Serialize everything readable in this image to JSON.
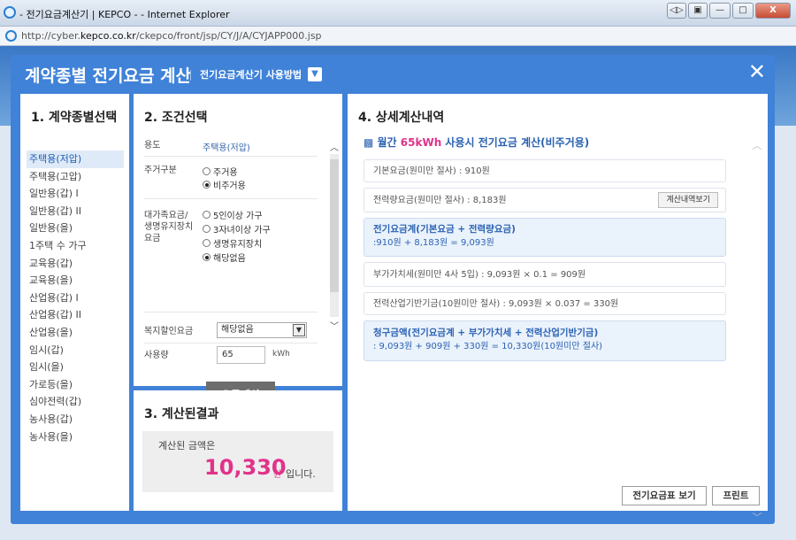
{
  "browser": {
    "title": "- 전기요금계산기 | KEPCO - - Internet Explorer",
    "url_prefix": "http://cyber.",
    "url_domain": "kepco.co.kr",
    "url_path": "/ckepco/front/jsp/CY/J/A/CYJAPP000.jsp",
    "buttons": [
      "◁▷",
      "▣",
      "—",
      "□",
      "X"
    ]
  },
  "modal": {
    "title": "계약종별 전기요금 계산",
    "help_link": "전기요금계산기 사용방법",
    "close": "✕"
  },
  "panel1": {
    "title": "1. 계약종별선택",
    "items": [
      "주택용(저압)",
      "주택용(고압)",
      "일반용(갑) I",
      "일반용(갑) II",
      "일반용(을)",
      "1주택 수 가구",
      "교육용(갑)",
      "교육용(을)",
      "산업용(갑) I",
      "산업용(갑) II",
      "산업용(을)",
      "임시(갑)",
      "임시(을)",
      "가로등(을)",
      "심야전력(갑)",
      "농사용(갑)",
      "농사용(을)"
    ],
    "active_index": 0
  },
  "panel2": {
    "title": "2. 조건선택",
    "use_label": "용도",
    "use_value": "주택용(저압)",
    "residence_label": "주거구분",
    "residence_options": [
      "주거용",
      "비주거용"
    ],
    "residence_selected": 1,
    "family_label": "대가족요금/\n생명유지장치\n요금",
    "family_options": [
      "5인이상 가구",
      "3자녀이상 가구",
      "생명유지장치",
      "해당없음"
    ],
    "family_selected": 3,
    "welfare_label": "복지할인요금",
    "welfare_value": "해당없음",
    "usage_label": "사용량",
    "usage_value": "65",
    "usage_unit": "kWh",
    "calc_button": "요금계산"
  },
  "panel3": {
    "title": "3. 계산된결과",
    "label": "계산된 금액은",
    "amount": "10,330",
    "unit": "원",
    "suffix": "입니다."
  },
  "panel4": {
    "title": "4. 상세계산내역",
    "header_prefix": "▩ 월간 ",
    "header_usage": "65kWh",
    "header_suffix": " 사용시 전기요금 계산(비주거용)",
    "basic": "기본요금(원미만 절사) : 910원",
    "energy": "전력량요금(원미만 절사) : 8,183원",
    "detail_button": "계산내역보기",
    "subtotal_title": "전기요금계(기본요금 + 전력량요금)",
    "subtotal_formula": ":910원 + 8,183원 = 9,093원",
    "vat": "부가가치세(원미만 4사 5입) : 9,093원 × 0.1 = 909원",
    "fund": "전력산업기반기금(10원미만 절사) : 9,093원 × 0.037 = 330원",
    "total_title": "청구금액(전기요금계 + 부가가치세 + 전력산업기반기금)",
    "total_formula": ": 9,093원 + 909원 + 330원 = 10,330원(10원미만 절사)",
    "tariff_button": "전기요금표 보기",
    "print_button": "프린트"
  }
}
